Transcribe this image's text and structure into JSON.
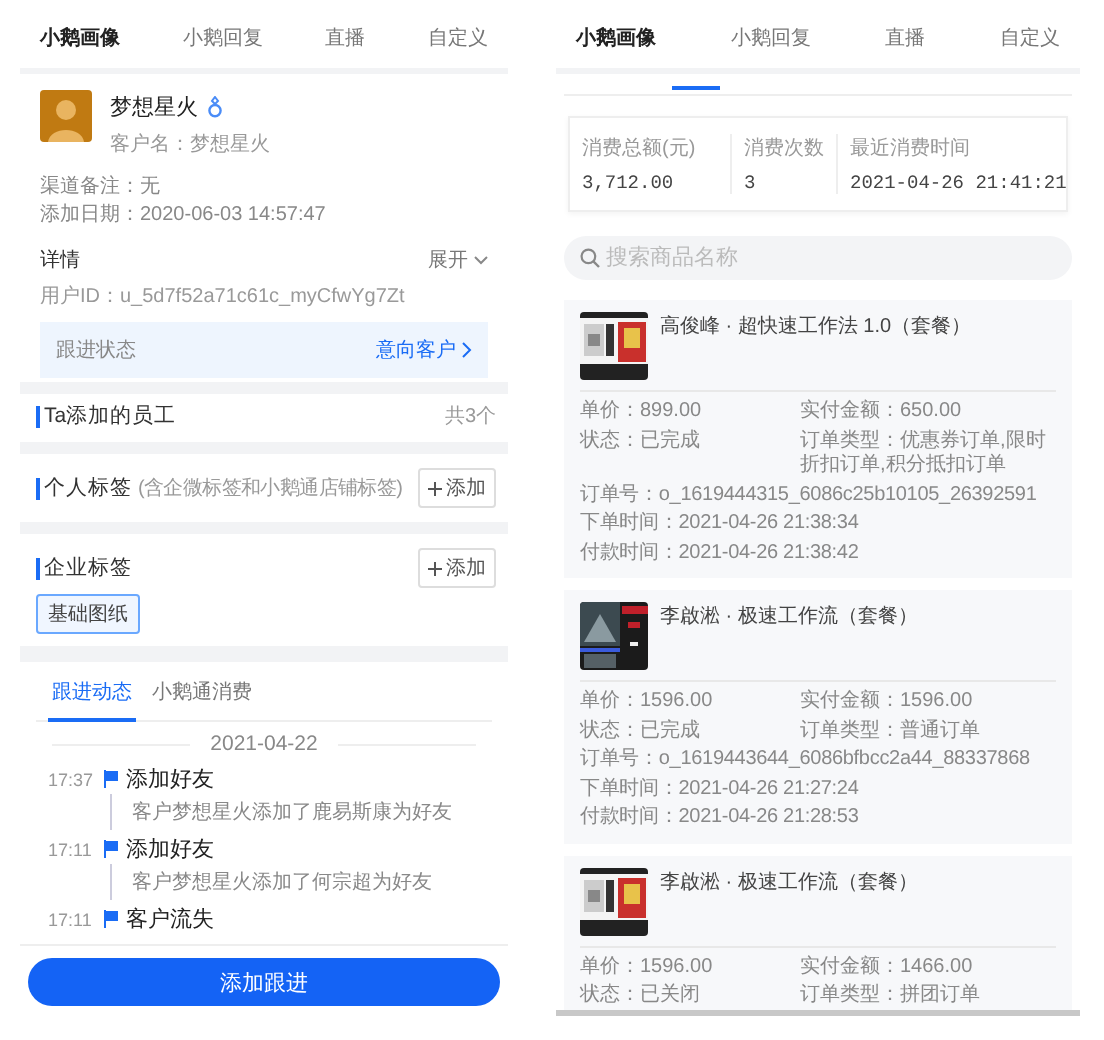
{
  "left": {
    "tabs": [
      {
        "label": "小鹅画像",
        "selected": true
      },
      {
        "label": "小鹅回复",
        "selected": false
      },
      {
        "label": "直播",
        "selected": false
      },
      {
        "label": "自定义",
        "selected": false
      }
    ],
    "profile": {
      "name": "梦想星火",
      "customer_name": "客户名：梦想星火"
    },
    "info": [
      "渠道备注：无",
      "添加日期：2020-06-03 14:57:47"
    ],
    "details": {
      "title": "详情",
      "toggle": "展开",
      "user_id": "用户ID：u_5d7f52a71c61c_myCfwYg7Zt"
    },
    "follow_status": {
      "label": "跟进状态",
      "value": "意向客户"
    },
    "sections": [
      {
        "kind": "count",
        "title": "Ta添加的员工",
        "count": "共3个"
      },
      {
        "kind": "tags",
        "title": "个人标签",
        "note": "(含企微标签和小鹅通店铺标签)",
        "add": "添加"
      },
      {
        "kind": "tags",
        "title": "企业标签",
        "add": "添加",
        "tags": [
          "基础图纸"
        ]
      }
    ],
    "feed_tabs": [
      {
        "label": "跟进动态",
        "selected": true
      },
      {
        "label": "小鹅通消费",
        "selected": false
      }
    ],
    "date": "2021-04-22",
    "events": [
      {
        "time": "17:37",
        "title": "添加好友",
        "text": "客户梦想星火添加了鹿易斯康为好友"
      },
      {
        "time": "17:11",
        "title": "添加好友",
        "text": "客户梦想星火添加了何宗超为好友"
      },
      {
        "time": "17:11",
        "title": "客户流失"
      }
    ],
    "button": "添加跟进"
  },
  "right": {
    "tabs": [
      {
        "label": "小鹅画像",
        "selected": true
      },
      {
        "label": "小鹅回复",
        "selected": false
      },
      {
        "label": "直播",
        "selected": false
      },
      {
        "label": "自定义",
        "selected": false
      }
    ],
    "summary": [
      {
        "label": "消费总额(元)",
        "value": "3,712.00"
      },
      {
        "label": "消费次数",
        "value": "3"
      },
      {
        "label": "最近消费时间",
        "value": "2021-04-26 21:41:21"
      }
    ],
    "search": {
      "placeholder": "搜索商品名称"
    },
    "orders": [
      {
        "title": "高俊峰 · 超快速工作法 1.0（套餐）",
        "fields": [
          {
            "kind": "half",
            "text": "单价：899.00"
          },
          {
            "kind": "half",
            "text": "实付金额：650.00"
          },
          {
            "kind": "half",
            "text": "状态：已完成"
          },
          {
            "kind": "half",
            "text": "订单类型：优惠券订单,限时折扣订单,积分抵扣订单"
          },
          {
            "kind": "full",
            "text": "订单号：o_1619444315_6086c25b10105_26392591"
          },
          {
            "kind": "full",
            "text": "下单时间：2021-04-26 21:38:34"
          },
          {
            "kind": "full",
            "text": "付款时间：2021-04-26 21:38:42"
          }
        ]
      },
      {
        "title": "李啟淞 · 极速工作流（套餐）",
        "fields": [
          {
            "kind": "half",
            "text": "单价：1596.00"
          },
          {
            "kind": "half",
            "text": "实付金额：1596.00"
          },
          {
            "kind": "half",
            "text": "状态：已完成"
          },
          {
            "kind": "half",
            "text": "订单类型：普通订单"
          },
          {
            "kind": "full",
            "text": "订单号：o_1619443644_6086bfbcc2a44_88337868"
          },
          {
            "kind": "full",
            "text": "下单时间：2021-04-26 21:27:24"
          },
          {
            "kind": "full",
            "text": "付款时间：2021-04-26 21:28:53"
          }
        ]
      },
      {
        "title": "李啟淞 · 极速工作流（套餐）",
        "fields": [
          {
            "kind": "half",
            "text": "单价：1596.00"
          },
          {
            "kind": "half",
            "text": "实付金额：1466.00"
          },
          {
            "kind": "half",
            "text": "状态：已关闭"
          },
          {
            "kind": "half",
            "text": "订单类型：拼团订单"
          }
        ]
      }
    ]
  }
}
